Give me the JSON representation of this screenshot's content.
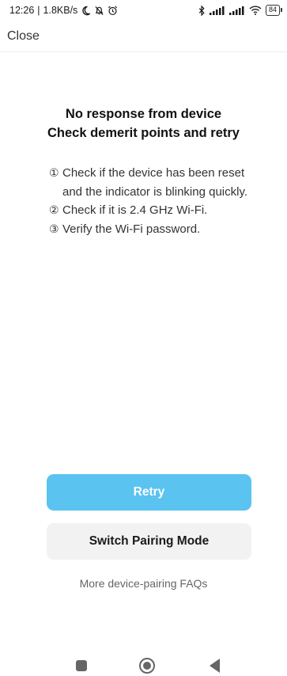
{
  "status_bar": {
    "time": "12:26",
    "separator": "|",
    "speed": "1.8KB/s",
    "left_icons": [
      "moon-icon",
      "bell-off-icon",
      "alarm-icon"
    ],
    "right_icons": [
      "bluetooth-icon",
      "signal-icon",
      "signal-icon",
      "wifi-icon"
    ],
    "battery": "84"
  },
  "header": {
    "close_label": "Close"
  },
  "message": {
    "title": "No response from device",
    "subtitle": "Check demerit points and retry"
  },
  "steps": [
    {
      "num": "①",
      "text": "Check if the device has been reset and the indicator is blinking quickly."
    },
    {
      "num": "②",
      "text": "Check if it is 2.4 GHz Wi-Fi."
    },
    {
      "num": "③",
      "text": "Verify the Wi-Fi password."
    }
  ],
  "actions": {
    "retry_label": "Retry",
    "switch_label": "Switch Pairing Mode",
    "faq_label": "More device-pairing FAQs"
  },
  "colors": {
    "primary": "#5ac3f0",
    "secondary_bg": "#f2f2f2",
    "muted_text": "#666666"
  }
}
